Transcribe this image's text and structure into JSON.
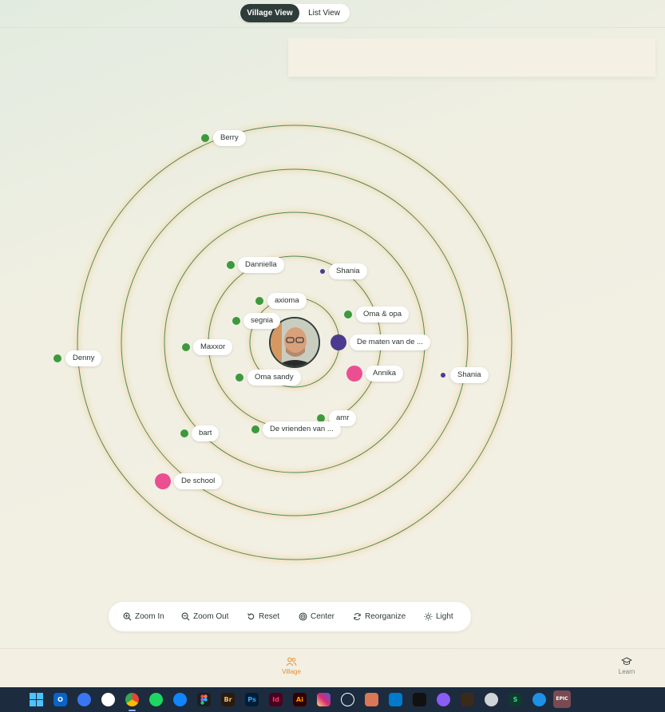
{
  "view_toggle": {
    "village": "Village View",
    "list": "List View",
    "active": "Village View"
  },
  "people": [
    {
      "id": "berry",
      "label": "Berry",
      "color": "#3c9a3c"
    },
    {
      "id": "danniella",
      "label": "Danniella",
      "color": "#3c9a3c"
    },
    {
      "id": "shania-1",
      "label": "Shania",
      "color": "#4b3b8f"
    },
    {
      "id": "axioma",
      "label": "axioma",
      "color": "#3c9a3c"
    },
    {
      "id": "segnia",
      "label": "segnia",
      "color": "#3c9a3c"
    },
    {
      "id": "oma-opa",
      "label": "Oma & opa",
      "color": "#3c9a3c"
    },
    {
      "id": "maxxor",
      "label": "Maxxor",
      "color": "#3c9a3c"
    },
    {
      "id": "de-maten",
      "label": "De maten van de ...",
      "color": "#4b3b8f"
    },
    {
      "id": "denny",
      "label": "Denny",
      "color": "#3c9a3c"
    },
    {
      "id": "annika",
      "label": "Annika",
      "color": "#ec4e92"
    },
    {
      "id": "shania-2",
      "label": "Shania",
      "color": "#4b3b8f"
    },
    {
      "id": "oma-sandy",
      "label": "Oma sandy",
      "color": "#3c9a3c"
    },
    {
      "id": "amr",
      "label": "amr",
      "color": "#3c9a3c"
    },
    {
      "id": "bart",
      "label": "bart",
      "color": "#3c9a3c"
    },
    {
      "id": "de-vrienden",
      "label": "De vrienden van ...",
      "color": "#3c9a3c"
    },
    {
      "id": "de-school",
      "label": "De school",
      "color": "#ec4e92"
    }
  ],
  "toolbar": {
    "zoom_in": "Zoom In",
    "zoom_out": "Zoom Out",
    "reset": "Reset",
    "center": "Center",
    "reorganize": "Reorganize",
    "light": "Light"
  },
  "bottom_nav": {
    "village": "Village",
    "learn": "Learn",
    "active_color": "#e3902f",
    "inactive_color": "#7c8580"
  },
  "taskbar": {
    "icons": [
      "windows-start",
      "outlook",
      "signal",
      "messenger",
      "chrome",
      "spotify",
      "bluesky",
      "figma",
      "bridge",
      "photoshop",
      "indesign",
      "illustrator",
      "instagram",
      "chatgpt",
      "claude",
      "vscode",
      "notion",
      "github",
      "app-orange",
      "app-circle",
      "app-s",
      "docker",
      "epic-games"
    ],
    "labels": {
      "bridge": "Br",
      "photoshop": "Ps",
      "indesign": "Id",
      "illustrator": "Ai",
      "epic-games": "EPIC"
    }
  }
}
